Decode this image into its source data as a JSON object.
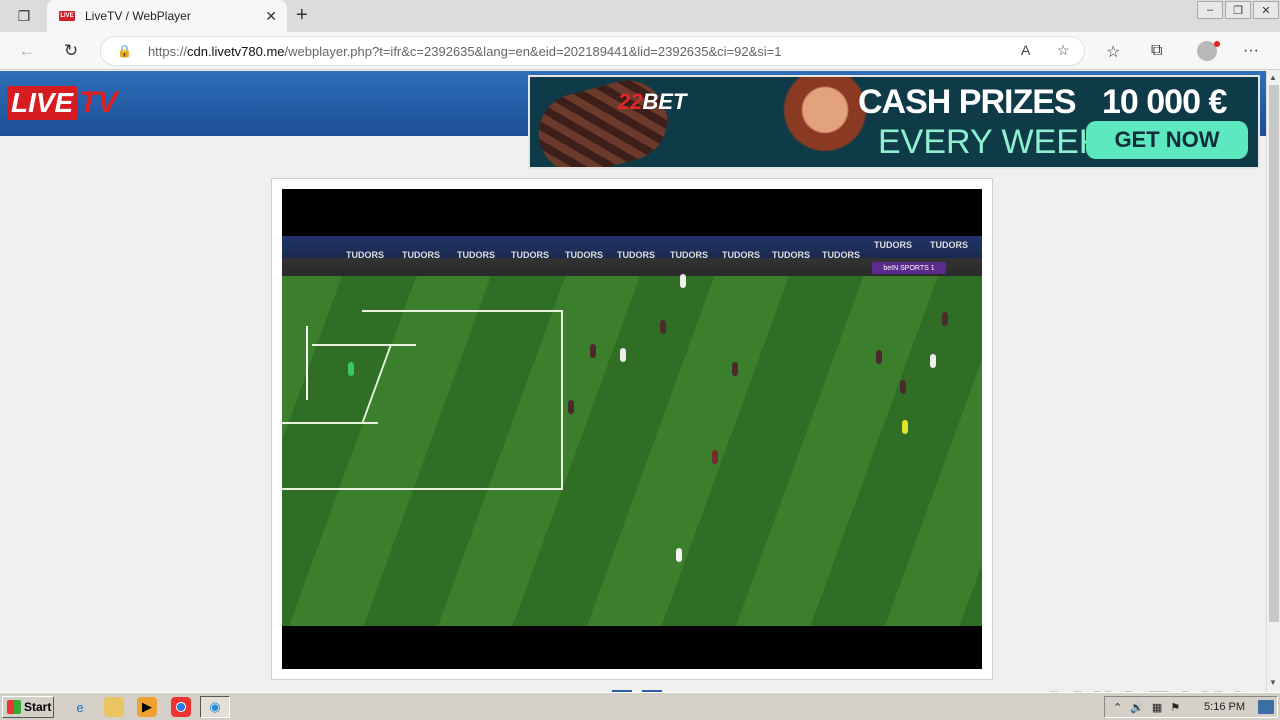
{
  "browser": {
    "tab_title": "LiveTV / WebPlayer",
    "tab_favicon_text": "LIVE",
    "url_prefix": "https://",
    "url_host": "cdn.livetv780.me",
    "url_path": "/webplayer.php?t=ifr&c=2392635&lang=en&eid=202189441&lid=2392635&ci=92&si=1"
  },
  "site": {
    "logo_live": "LIVE",
    "logo_tv": "TV"
  },
  "ad": {
    "brand_num": "22",
    "brand_text": "BET",
    "headline_1": "CASH PRIZES",
    "headline_2": "10 000 €",
    "headline_3": "EVERY WEEK",
    "cta": "GET NOW"
  },
  "video": {
    "ad_boards": [
      "TUDORS",
      "TUDORS",
      "TUDORS",
      "TUDORS",
      "TUDORS",
      "TUDORS",
      "TUDORS",
      "TUDORS",
      "TUDORS",
      "TUDORS",
      "TUDORS",
      "TUDORS"
    ],
    "channel_logo": "beIN SPORTS 1"
  },
  "watermark": "ANY RUN",
  "taskbar": {
    "start_label": "Start",
    "clock": "5:16 PM"
  }
}
